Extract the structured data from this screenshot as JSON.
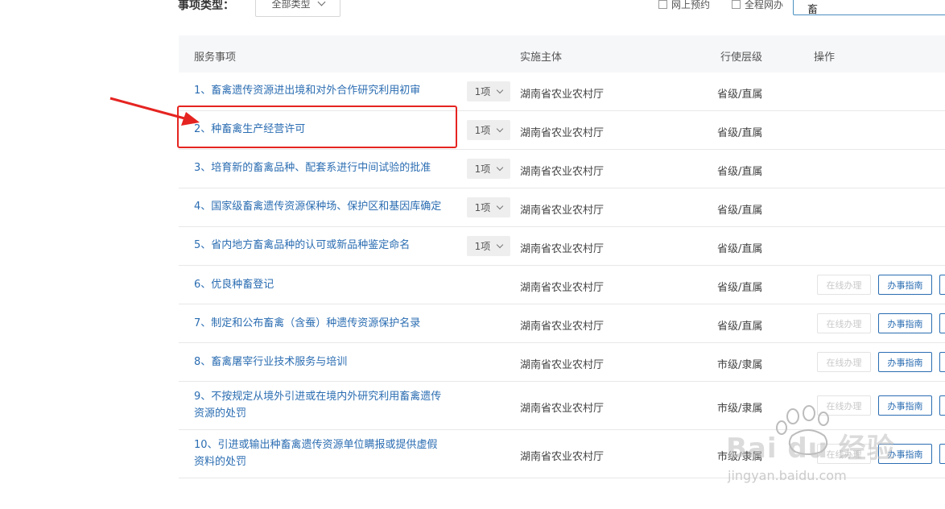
{
  "filter": {
    "label": "事项类型：",
    "type_select_value": "全部类型",
    "online_reserve_label": "网上预约",
    "full_online_label": "全程网办",
    "search_value": "畜"
  },
  "table": {
    "headers": {
      "service": "服务事项",
      "subject": "实施主体",
      "level": "行使层级",
      "action": "操作"
    },
    "rows": [
      {
        "name": "1、畜禽遗传资源进出境和对外合作研究利用初审",
        "count": "1项",
        "subject": "湖南省农业农村厅",
        "level": "省级/直属"
      },
      {
        "name": "2、种畜禽生产经营许可",
        "count": "1项",
        "subject": "湖南省农业农村厅",
        "level": "省级/直属"
      },
      {
        "name": "3、培育新的畜禽品种、配套系进行中间试验的批准",
        "count": "1项",
        "subject": "湖南省农业农村厅",
        "level": "省级/直属"
      },
      {
        "name": "4、国家级畜禽遗传资源保种场、保护区和基因库确定",
        "count": "1项",
        "subject": "湖南省农业农村厅",
        "level": "省级/直属"
      },
      {
        "name": "5、省内地方畜禽品种的认可或新品种鉴定命名",
        "count": "1项",
        "subject": "湖南省农业农村厅",
        "level": "省级/直属"
      },
      {
        "name": "6、优良种畜登记",
        "subject": "湖南省农业农村厅",
        "level": "省级/直属",
        "online": "在线办理",
        "guide": "办事指南"
      },
      {
        "name": "7、制定和公布畜禽（含蚕）种遗传资源保护名录",
        "subject": "湖南省农业农村厅",
        "level": "省级/直属",
        "online": "在线办理",
        "guide": "办事指南"
      },
      {
        "name": "8、畜禽屠宰行业技术服务与培训",
        "subject": "湖南省农业农村厅",
        "level": "市级/隶属",
        "online": "在线办理",
        "guide": "办事指南"
      },
      {
        "name_line1": "9、不按规定从境外引进或在境内外研究利用畜禽遗传",
        "name_line2": "资源的处罚",
        "subject": "湖南省农业农村厅",
        "level": "市级/隶属",
        "online": "在线办理",
        "guide": "办事指南"
      },
      {
        "name_line1": "10、引进或输出种畜禽遗传资源单位瞒报或提供虚假",
        "name_line2": "资料的处罚",
        "subject": "湖南省农业农村厅",
        "level": "市级/隶属",
        "online": "在线办理",
        "guide": "办事指南"
      }
    ]
  },
  "watermark": {
    "brand": "Bai du 经验",
    "url": "jingyan.baidu.com"
  },
  "colors": {
    "link": "#2b6db2",
    "annotation": "#e52421",
    "header_bg": "#f6f7f9"
  }
}
